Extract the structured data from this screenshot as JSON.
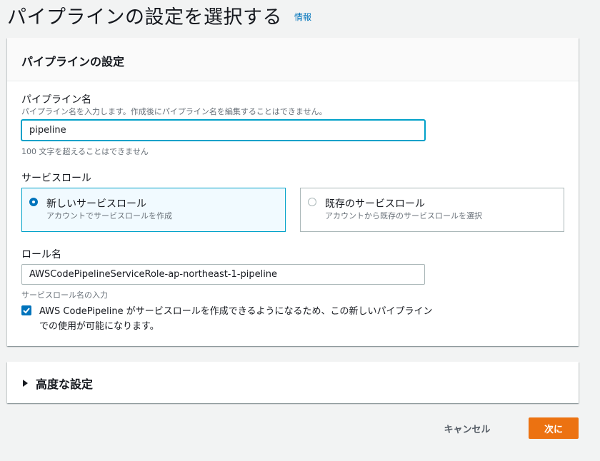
{
  "header": {
    "title": "パイプラインの設定を選択する",
    "info_link": "情報"
  },
  "settings": {
    "title": "パイプラインの設定",
    "pipeline_name": {
      "label": "パイプライン名",
      "description": "パイプライン名を入力します。作成後にパイプライン名を編集することはできません。",
      "value": "pipeline",
      "constraint": "100 文字を超えることはできません"
    },
    "service_role": {
      "label": "サービスロール",
      "options": [
        {
          "title": "新しいサービスロール",
          "description": "アカウントでサービスロールを作成",
          "selected": true
        },
        {
          "title": "既存のサービスロール",
          "description": "アカウントから既存のサービスロールを選択",
          "selected": false
        }
      ]
    },
    "role_name": {
      "label": "ロール名",
      "value": "AWSCodePipelineServiceRole-ap-northeast-1-pipeline",
      "hint": "サービスロール名の入力"
    },
    "consent": {
      "checked": true,
      "text": "AWS CodePipeline がサービスロールを作成できるようになるため、この新しいパイプラインでの使用が可能になります。"
    }
  },
  "advanced": {
    "title": "高度な設定",
    "expanded": false
  },
  "footer": {
    "cancel_label": "キャンセル",
    "next_label": "次に"
  },
  "colors": {
    "accent": "#0073bb",
    "primary_button": "#ec7211",
    "focus": "#00a1c9",
    "selected_tile_bg": "#f1faff"
  }
}
